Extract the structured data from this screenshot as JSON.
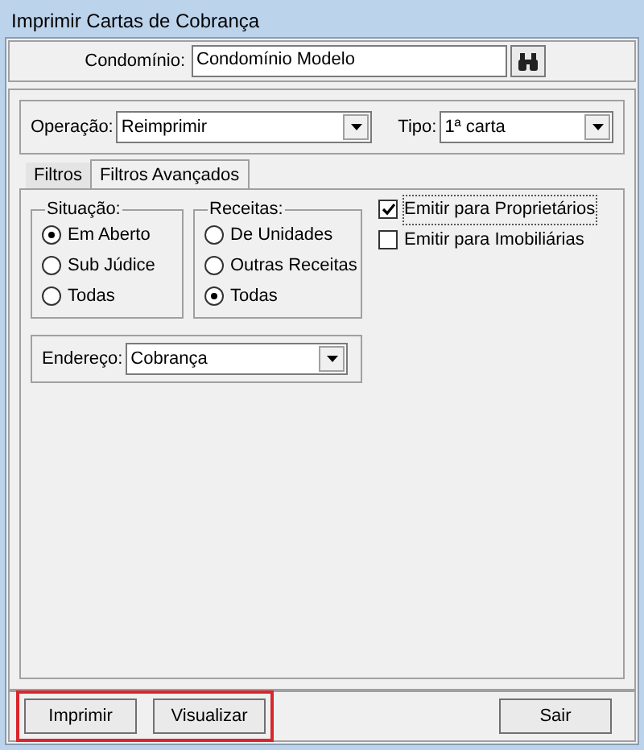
{
  "window": {
    "title": "Imprimir Cartas de Cobrança"
  },
  "condominio": {
    "label": "Condomínio:",
    "value": "Condomínio Modelo"
  },
  "operacao": {
    "label": "Operação:",
    "value": "Reimprimir"
  },
  "tipo": {
    "label": "Tipo:",
    "value": "1ª carta"
  },
  "tabs": [
    {
      "label": "Filtros",
      "selected": false
    },
    {
      "label": "Filtros Avançados",
      "selected": true
    }
  ],
  "situacao": {
    "title": "Situação:",
    "options": [
      {
        "label": "Em Aberto",
        "selected": true
      },
      {
        "label": "Sub Júdice",
        "selected": false
      },
      {
        "label": "Todas",
        "selected": false
      }
    ]
  },
  "receitas": {
    "title": "Receitas:",
    "options": [
      {
        "label": "De Unidades",
        "selected": false
      },
      {
        "label": "Outras Receitas",
        "selected": false
      },
      {
        "label": "Todas",
        "selected": true
      }
    ]
  },
  "checkboxes": [
    {
      "label": "Emitir para Proprietários",
      "checked": true,
      "focused": true
    },
    {
      "label": "Emitir para Imobiliárias",
      "checked": false,
      "focused": false
    }
  ],
  "endereco": {
    "label": "Endereço:",
    "value": "Cobrança"
  },
  "footer": {
    "highlighted_buttons": [
      {
        "label": "Imprimir"
      },
      {
        "label": "Visualizar"
      }
    ],
    "buttons": [
      {
        "label": "Sair"
      }
    ]
  }
}
